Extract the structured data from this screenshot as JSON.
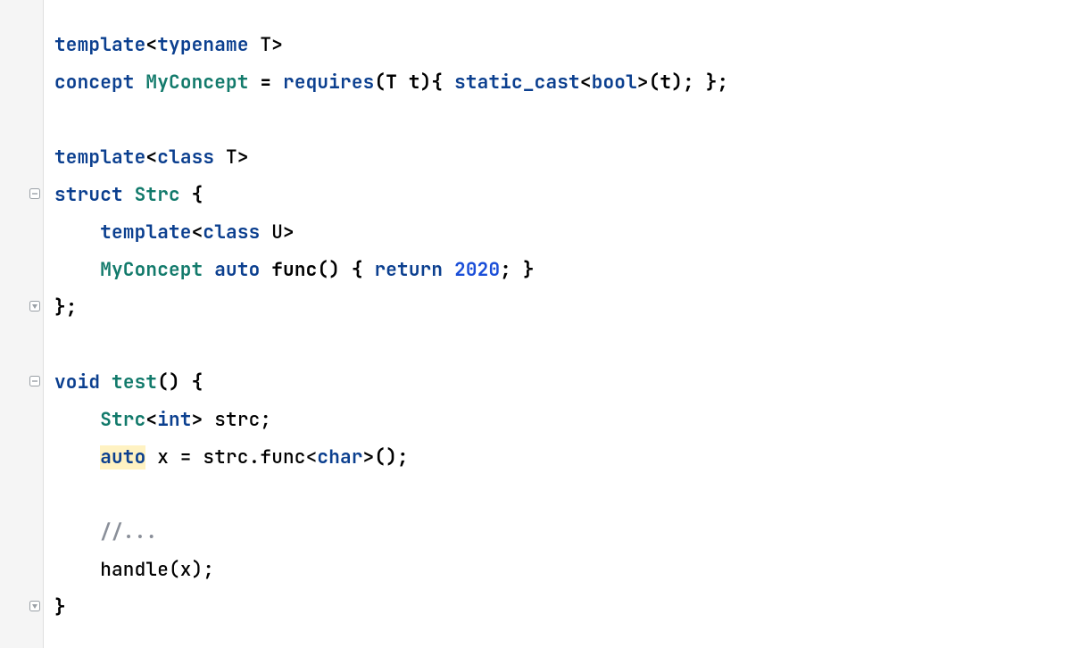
{
  "code": {
    "l1": {
      "t1": "template",
      "t2": "<",
      "t3": "typename",
      "t4": " T",
      "t5": ">"
    },
    "l2": {
      "t1": "concept",
      "t2": " ",
      "t3": "MyConcept",
      "t4": " = ",
      "t5": "requires",
      "t6": "(T t){",
      "t7": " ",
      "t8": "static_cast",
      "t9": "<",
      "t10": "bool",
      "t11": ">",
      "t12": "(t); };"
    },
    "l3": {},
    "l4": {
      "t1": "template",
      "t2": "<",
      "t3": "class",
      "t4": " T",
      "t5": ">"
    },
    "l5": {
      "t1": "struct",
      "t2": " ",
      "t3": "Strc",
      "t4": " {"
    },
    "l6": {
      "t1": "    ",
      "t2": "template",
      "t3": "<",
      "t4": "class",
      "t5": " U",
      "t6": ">"
    },
    "l7": {
      "t1": "    ",
      "t2": "MyConcept",
      "t3": " ",
      "t4": "auto",
      "t5": " ",
      "t6": "func",
      "t7": "() { ",
      "t8": "return",
      "t9": " ",
      "t10": "2020",
      "t11": "; }"
    },
    "l8": {
      "t1": "};"
    },
    "l9": {},
    "l10": {
      "t1": "void",
      "t2": " ",
      "t3": "test",
      "t4": "() {"
    },
    "l11": {
      "t1": "    ",
      "t2": "Strc",
      "t3": "<",
      "t4": "int",
      "t5": ">",
      "t6": " strc;"
    },
    "l12": {
      "t1": "    ",
      "t2": "auto",
      "t3": " x = strc.func<",
      "t4": "char",
      "t5": ">();"
    },
    "l13": {},
    "l14": {
      "t1": "    ",
      "t2": "//..."
    },
    "l15": {
      "t1": "    ",
      "t2": "handle(x);"
    },
    "l16": {
      "t1": "}"
    }
  }
}
